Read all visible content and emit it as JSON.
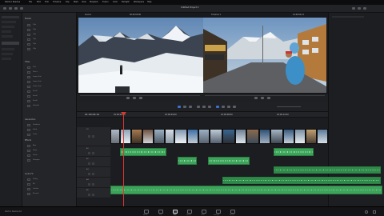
{
  "menubar": {
    "app": "DaVinci Resolve",
    "items": [
      "File",
      "Edit",
      "Trim",
      "Timeline",
      "Clip",
      "Mark",
      "View",
      "Playback",
      "Fusion",
      "Color",
      "Fairlight",
      "Workspace",
      "Help"
    ]
  },
  "appbar": {
    "project_title": "Untitled Project 2"
  },
  "media_panel": {
    "sections": [
      {
        "title": "Master",
        "items": [
          "Clip",
          "Clip",
          "Clip",
          "Clip",
          "Clip",
          "Clip"
        ]
      },
      {
        "title": "Titles",
        "items": [
          "Text",
          "Text+",
          "Lower 3rd",
          "Lower 3rd",
          "Lower 3rd",
          "Scroll",
          "Scroll",
          "Scroll",
          "Subtitle"
        ]
      },
      {
        "title": "Generators",
        "items": [
          "Gradient",
          "Solid",
          "Color"
        ]
      },
      {
        "title": "Effects",
        "items": [
          "Blur",
          "Glow",
          "Grain",
          "Sharpen"
        ]
      },
      {
        "title": "Audio FX",
        "items": [
          "Delay",
          "EQ",
          "Limiter",
          "Reverb"
        ]
      }
    ]
  },
  "viewer": {
    "left_label": "Source",
    "left_timecode": "00:00:00:00",
    "right_label": "Timeline 1",
    "right_timecode": "01:00:04:12"
  },
  "timeline": {
    "timecode": "01:00:04:12",
    "tracks": [
      {
        "name": "V1",
        "kind": "video"
      },
      {
        "name": "A1",
        "kind": "audio"
      },
      {
        "name": "A2",
        "kind": "audio"
      },
      {
        "name": "A3",
        "kind": "audio"
      },
      {
        "name": "A4",
        "kind": "audio"
      },
      {
        "name": "A5",
        "kind": "audio"
      }
    ],
    "ruler_ticks": [
      "01:00:00:00",
      "01:00:04:00",
      "01:00:08:00",
      "01:00:12:00"
    ]
  },
  "pages": [
    "Media",
    "Cut",
    "Edit",
    "Fusion",
    "Color",
    "Fairlight",
    "Deliver"
  ],
  "active_page": "Edit",
  "status": {
    "left": "DaVinci Resolve 16"
  },
  "colors": {
    "accent": "#3d6fd1",
    "playhead": "#e0352b",
    "audio_clip": "#3ea35a"
  }
}
